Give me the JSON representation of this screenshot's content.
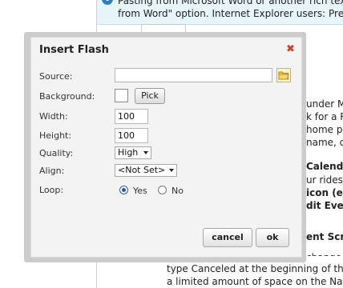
{
  "background_page": {
    "notice_line1": "Pasting from Microsoft Word or another rich text/html",
    "notice_line2": "from Word\" option. Internet Explorer users: Press SHIFT",
    "right_column": [
      "under M",
      "k for a R",
      "home p",
      "name, cli",
      "Calenda",
      "ur rides w",
      "icon (ed",
      "dit Even",
      "ent Scre",
      "change"
    ],
    "bottom_lines": [
      "type Canceled at the beginning of the r",
      "a limited amount of space on the Name"
    ]
  },
  "dialog": {
    "title": "Insert Flash",
    "labels": {
      "source": "Source:",
      "background": "Background:",
      "width": "Width:",
      "height": "Height:",
      "quality": "Quality:",
      "align": "Align:",
      "loop": "Loop:"
    },
    "source_value": "",
    "pick_label": "Pick",
    "width_value": "100",
    "height_value": "100",
    "quality_value": "High",
    "align_value": "<Not Set>",
    "loop_yes": "Yes",
    "loop_no": "No",
    "loop_selected": "Yes",
    "cancel_label": "cancel",
    "ok_label": "ok"
  },
  "colors": {
    "notice_bg": "#e7f5fb",
    "info_icon": "#2f7fc1",
    "close_icon": "#d8372b",
    "dialog_frame": "#cccccc",
    "dialog_bg": "#f3f3f3"
  }
}
